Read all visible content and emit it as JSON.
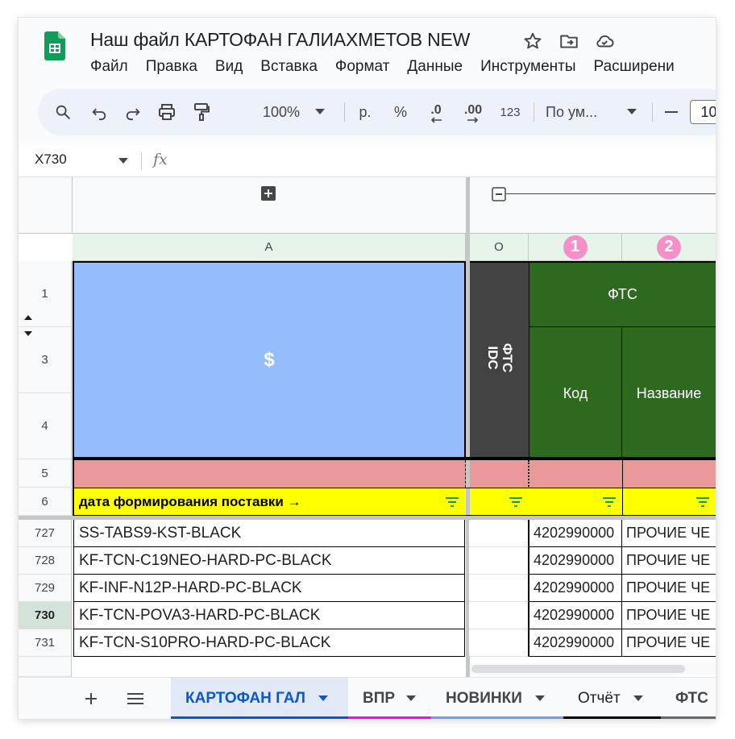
{
  "document": {
    "title": "Наш файл КАРТОФАН ГАЛИАХМЕТОВ NEW"
  },
  "menu": [
    "Файл",
    "Правка",
    "Вид",
    "Вставка",
    "Формат",
    "Данные",
    "Инструменты",
    "Расширени"
  ],
  "toolbar": {
    "zoom": "100%",
    "currency": "р.",
    "percent": "%",
    "dec_decrease": ".0",
    "dec_increase": ".00",
    "number_format": "123",
    "font": "По ум...",
    "font_size": "10"
  },
  "formula_bar": {
    "cell_ref": "X730",
    "fx": "fx"
  },
  "columns": {
    "a": "A",
    "o": "O",
    "badge1": "1",
    "badge2": "2"
  },
  "row_numbers": {
    "r1": "1",
    "r3": "3",
    "r4": "4",
    "r5": "5",
    "r6": "6"
  },
  "header_cells": {
    "dollar": "$",
    "fts_idc": "ФТС IDC",
    "fts": "ФТС",
    "kod": "Код",
    "nazvanie": "Название",
    "date_label": "дата формирования поставки →"
  },
  "rows": [
    {
      "num": "727",
      "sku": "SS-TABS9-KST-BLACK",
      "code": "4202990000",
      "name": "ПРОЧИЕ ЧЕ"
    },
    {
      "num": "728",
      "sku": "KF-TCN-C19NEO-HARD-PC-BLACK",
      "code": "4202990000",
      "name": "ПРОЧИЕ ЧЕ"
    },
    {
      "num": "729",
      "sku": "KF-INF-N12P-HARD-PC-BLACK",
      "code": "4202990000",
      "name": "ПРОЧИЕ ЧЕ"
    },
    {
      "num": "730",
      "sku": "KF-TCN-POVA3-HARD-PC-BLACK",
      "code": "4202990000",
      "name": "ПРОЧИЕ ЧЕ"
    },
    {
      "num": "731",
      "sku": "KF-TCN-S10PRO-HARD-PC-BLACK",
      "code": "4202990000",
      "name": "ПРОЧИЕ ЧЕ"
    }
  ],
  "tabs": [
    {
      "label": "КАРТОФАН ГАЛ",
      "color": "#0b57d0"
    },
    {
      "label": "ВПР",
      "color": "#ff00ff"
    },
    {
      "label": "НОВИНКИ",
      "color": "#6d9eeb"
    },
    {
      "label": "Отчёт",
      "color": "#000000"
    },
    {
      "label": "ФТС",
      "color": "#666666"
    }
  ],
  "colors": {
    "blue_header": "#95bdfc",
    "dark_header": "#434343",
    "green_header": "#2d6a1f",
    "pink_row": "#ea9999",
    "yellow_row": "#ffff00",
    "badge": "#f48fc9",
    "active_tab": "#0b57d0"
  }
}
